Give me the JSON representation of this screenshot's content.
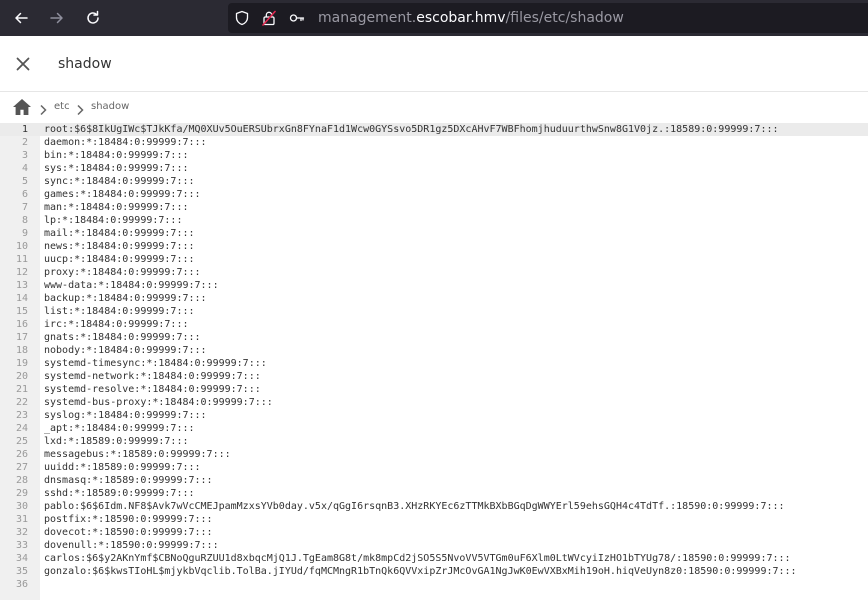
{
  "browser": {
    "url_prefix": "management.",
    "url_domain": "escobar.hmv",
    "url_path": "/files/etc/shadow",
    "colors": {
      "toolbar": "#2b2a33",
      "urlbar": "#1c1b22"
    }
  },
  "header": {
    "title": "shadow"
  },
  "breadcrumb": {
    "items": [
      "etc",
      "shadow"
    ]
  },
  "editor": {
    "lines": [
      {
        "n": "1",
        "text": "root:$6$8IkUgIWc$TJkKfa/MQ0XUv5OuERSUbrxGn8FYnaF1d1Wcw0GYSsvo5DR1gz5DXcAHvF7WBFhomjhuduurthwSnw8G1V0jz.:18589:0:99999:7:::"
      },
      {
        "n": "2",
        "text": "daemon:*:18484:0:99999:7:::"
      },
      {
        "n": "3",
        "text": "bin:*:18484:0:99999:7:::"
      },
      {
        "n": "4",
        "text": "sys:*:18484:0:99999:7:::"
      },
      {
        "n": "5",
        "text": "sync:*:18484:0:99999:7:::"
      },
      {
        "n": "6",
        "text": "games:*:18484:0:99999:7:::"
      },
      {
        "n": "7",
        "text": "man:*:18484:0:99999:7:::"
      },
      {
        "n": "8",
        "text": "lp:*:18484:0:99999:7:::"
      },
      {
        "n": "9",
        "text": "mail:*:18484:0:99999:7:::"
      },
      {
        "n": "10",
        "text": "news:*:18484:0:99999:7:::"
      },
      {
        "n": "11",
        "text": "uucp:*:18484:0:99999:7:::"
      },
      {
        "n": "12",
        "text": "proxy:*:18484:0:99999:7:::"
      },
      {
        "n": "13",
        "text": "www-data:*:18484:0:99999:7:::"
      },
      {
        "n": "14",
        "text": "backup:*:18484:0:99999:7:::"
      },
      {
        "n": "15",
        "text": "list:*:18484:0:99999:7:::"
      },
      {
        "n": "16",
        "text": "irc:*:18484:0:99999:7:::"
      },
      {
        "n": "17",
        "text": "gnats:*:18484:0:99999:7:::"
      },
      {
        "n": "18",
        "text": "nobody:*:18484:0:99999:7:::"
      },
      {
        "n": "19",
        "text": "systemd-timesync:*:18484:0:99999:7:::"
      },
      {
        "n": "20",
        "text": "systemd-network:*:18484:0:99999:7:::"
      },
      {
        "n": "21",
        "text": "systemd-resolve:*:18484:0:99999:7:::"
      },
      {
        "n": "22",
        "text": "systemd-bus-proxy:*:18484:0:99999:7:::"
      },
      {
        "n": "23",
        "text": "syslog:*:18484:0:99999:7:::"
      },
      {
        "n": "24",
        "text": "_apt:*:18484:0:99999:7:::"
      },
      {
        "n": "25",
        "text": "lxd:*:18589:0:99999:7:::"
      },
      {
        "n": "26",
        "text": "messagebus:*:18589:0:99999:7:::"
      },
      {
        "n": "27",
        "text": "uuidd:*:18589:0:99999:7:::"
      },
      {
        "n": "28",
        "text": "dnsmasq:*:18589:0:99999:7:::"
      },
      {
        "n": "29",
        "text": "sshd:*:18589:0:99999:7:::"
      },
      {
        "n": "30",
        "text": "pablo:$6$6Idm.NF8$Avk7wVcCMEJpamMzxsYVb0day.v5x/qGgI6rsqnB3.XHzRKYEc6zTTMkBXbBGqDgWWYErl59ehsGQH4c4TdTf.:18590:0:99999:7:::"
      },
      {
        "n": "31",
        "text": "postfix:*:18590:0:99999:7:::"
      },
      {
        "n": "32",
        "text": "dovecot:*:18590:0:99999:7:::"
      },
      {
        "n": "33",
        "text": "dovenull:*:18590:0:99999:7:::"
      },
      {
        "n": "34",
        "text": "carlos:$6$y2AKnYmf$CBNoQguRZUU1d8xbqcMjQ1J.TgEam8G8t/mk8mpCd2jSO5S5NvoVV5VTGm0uF6Xlm0LtWVcyiIzHO1bTYUg78/:18590:0:99999:7:::"
      },
      {
        "n": "35",
        "text": "gonzalo:$6$kwsTIoHL$mjykbVqclib.TolBa.jIYUd/fqMCMngR1bTnQk6QVVxipZrJMcOvGA1NgJwK0EwVXBxMih19oH.hiqVeUyn8z0:18590:0:99999:7:::"
      },
      {
        "n": "36",
        "text": ""
      }
    ],
    "active_line": 1,
    "colors": {
      "gutter": "#f0f0f0",
      "active_line": "#ebebeb",
      "text": "#333333",
      "line_number": "#999999"
    }
  },
  "icons": {
    "back": "back-arrow-icon",
    "forward": "forward-arrow-icon",
    "reload": "reload-icon",
    "shield": "shield-icon",
    "lock": "insecure-lock-icon",
    "key": "key-icon",
    "close": "close-icon",
    "home": "home-icon",
    "chevron": "chevron-right-icon"
  }
}
